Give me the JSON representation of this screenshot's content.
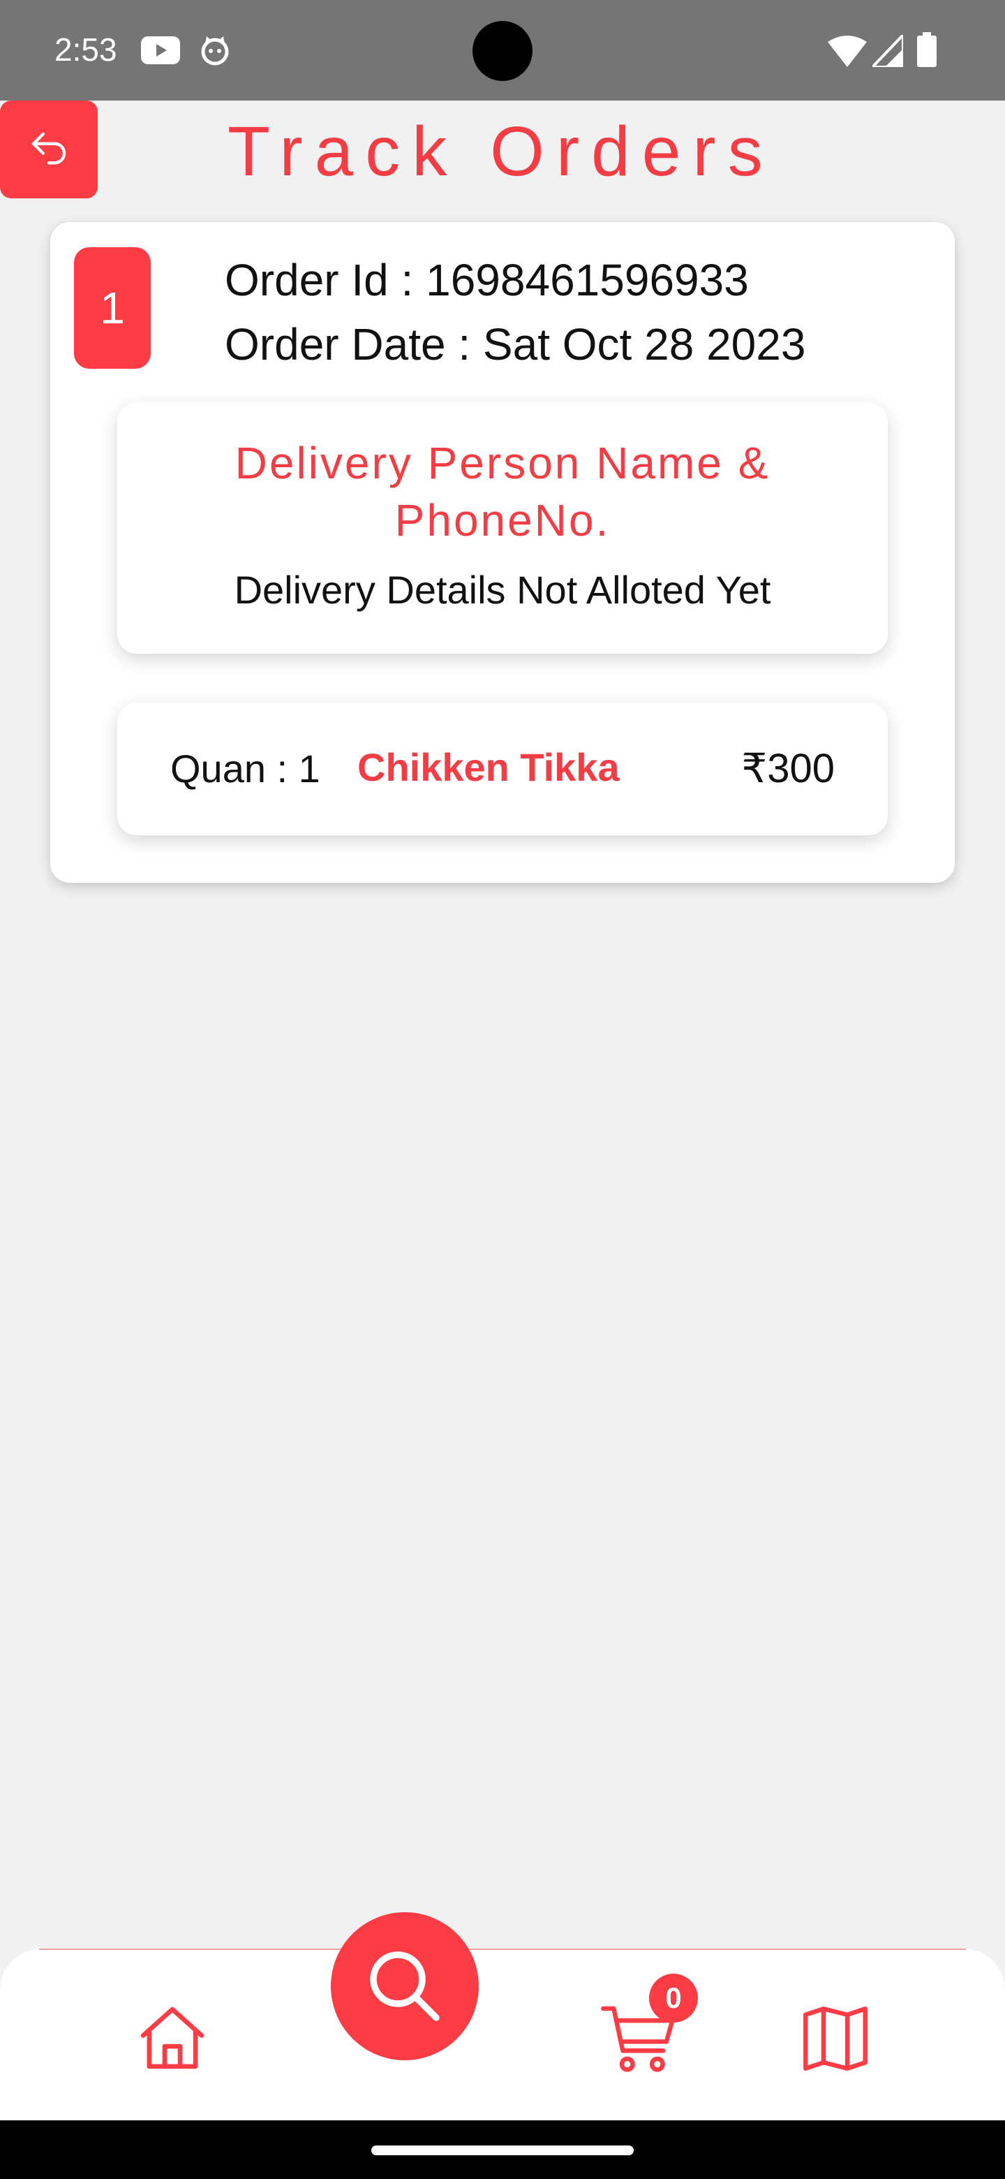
{
  "status_bar": {
    "time": "2:53",
    "icons": [
      "youtube-icon",
      "cat-icon",
      "wifi-icon",
      "signal-icon",
      "battery-icon"
    ]
  },
  "header": {
    "title": "Track Orders",
    "back_icon": "back-arrow-icon"
  },
  "orders": [
    {
      "index": "1",
      "order_id": "Order Id : 1698461596933",
      "order_date": "Order Date : Sat Oct 28 2023",
      "delivery": {
        "heading": "Delivery Person Name & PhoneNo.",
        "status": "Delivery Details Not Alloted Yet"
      },
      "items": [
        {
          "quantity": "Quan : 1",
          "name": "Chikken Tikka",
          "price": "₹300"
        }
      ]
    }
  ],
  "bottom_nav": {
    "items": [
      "home-icon",
      "search-icon",
      "cart-icon",
      "map-icon"
    ],
    "cart_count": "0"
  },
  "colors": {
    "accent": "#fc3c44",
    "title_text": "#f33c44",
    "background": "#f1f1f1",
    "status_bar": "#757575"
  }
}
